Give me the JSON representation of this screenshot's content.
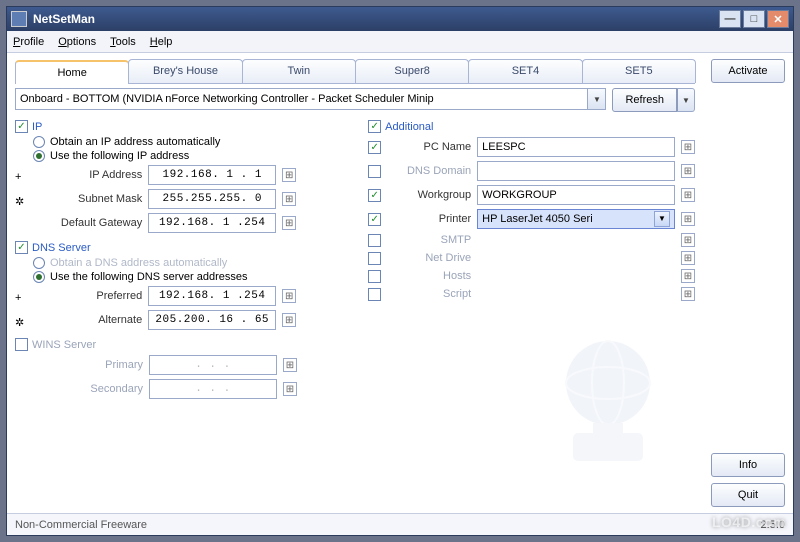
{
  "window": {
    "title": "NetSetMan"
  },
  "menu": {
    "profile": "Profile",
    "options": "Options",
    "tools": "Tools",
    "help": "Help"
  },
  "tabs": [
    "Home",
    "Brey's House",
    "Twin",
    "Super8",
    "SET4",
    "SET5"
  ],
  "buttons": {
    "activate": "Activate",
    "refresh": "Refresh",
    "info": "Info",
    "quit": "Quit"
  },
  "adapter": {
    "value": "Onboard - BOTTOM (NVIDIA nForce Networking Controller - Packet Scheduler Minip"
  },
  "ip": {
    "title": "IP",
    "obtain": "Obtain an IP address automatically",
    "use": "Use the following IP address",
    "addr_label": "IP Address",
    "addr": "192.168. 1 . 1",
    "mask_label": "Subnet Mask",
    "mask": "255.255.255. 0",
    "gw_label": "Default Gateway",
    "gw": "192.168. 1 .254"
  },
  "dns": {
    "title": "DNS Server",
    "obtain": "Obtain a DNS address automatically",
    "use": "Use the following DNS server addresses",
    "pref_label": "Preferred",
    "pref": "192.168. 1 .254",
    "alt_label": "Alternate",
    "alt": "205.200. 16 . 65"
  },
  "wins": {
    "title": "WINS Server",
    "prim_label": "Primary",
    "prim": ".   .   .",
    "sec_label": "Secondary",
    "sec": ".   .   ."
  },
  "additional": {
    "title": "Additional",
    "pcname_label": "PC Name",
    "pcname": "LEESPC",
    "dnsdomain_label": "DNS Domain",
    "dnsdomain": "",
    "workgroup_label": "Workgroup",
    "workgroup": "WORKGROUP",
    "printer_label": "Printer",
    "printer": "HP LaserJet 4050 Seri",
    "smtp_label": "SMTP",
    "netdrive_label": "Net Drive",
    "hosts_label": "Hosts",
    "script_label": "Script"
  },
  "status": {
    "left": "Non-Commercial Freeware",
    "right": "2.5.0"
  },
  "watermark": "LO4D.com"
}
